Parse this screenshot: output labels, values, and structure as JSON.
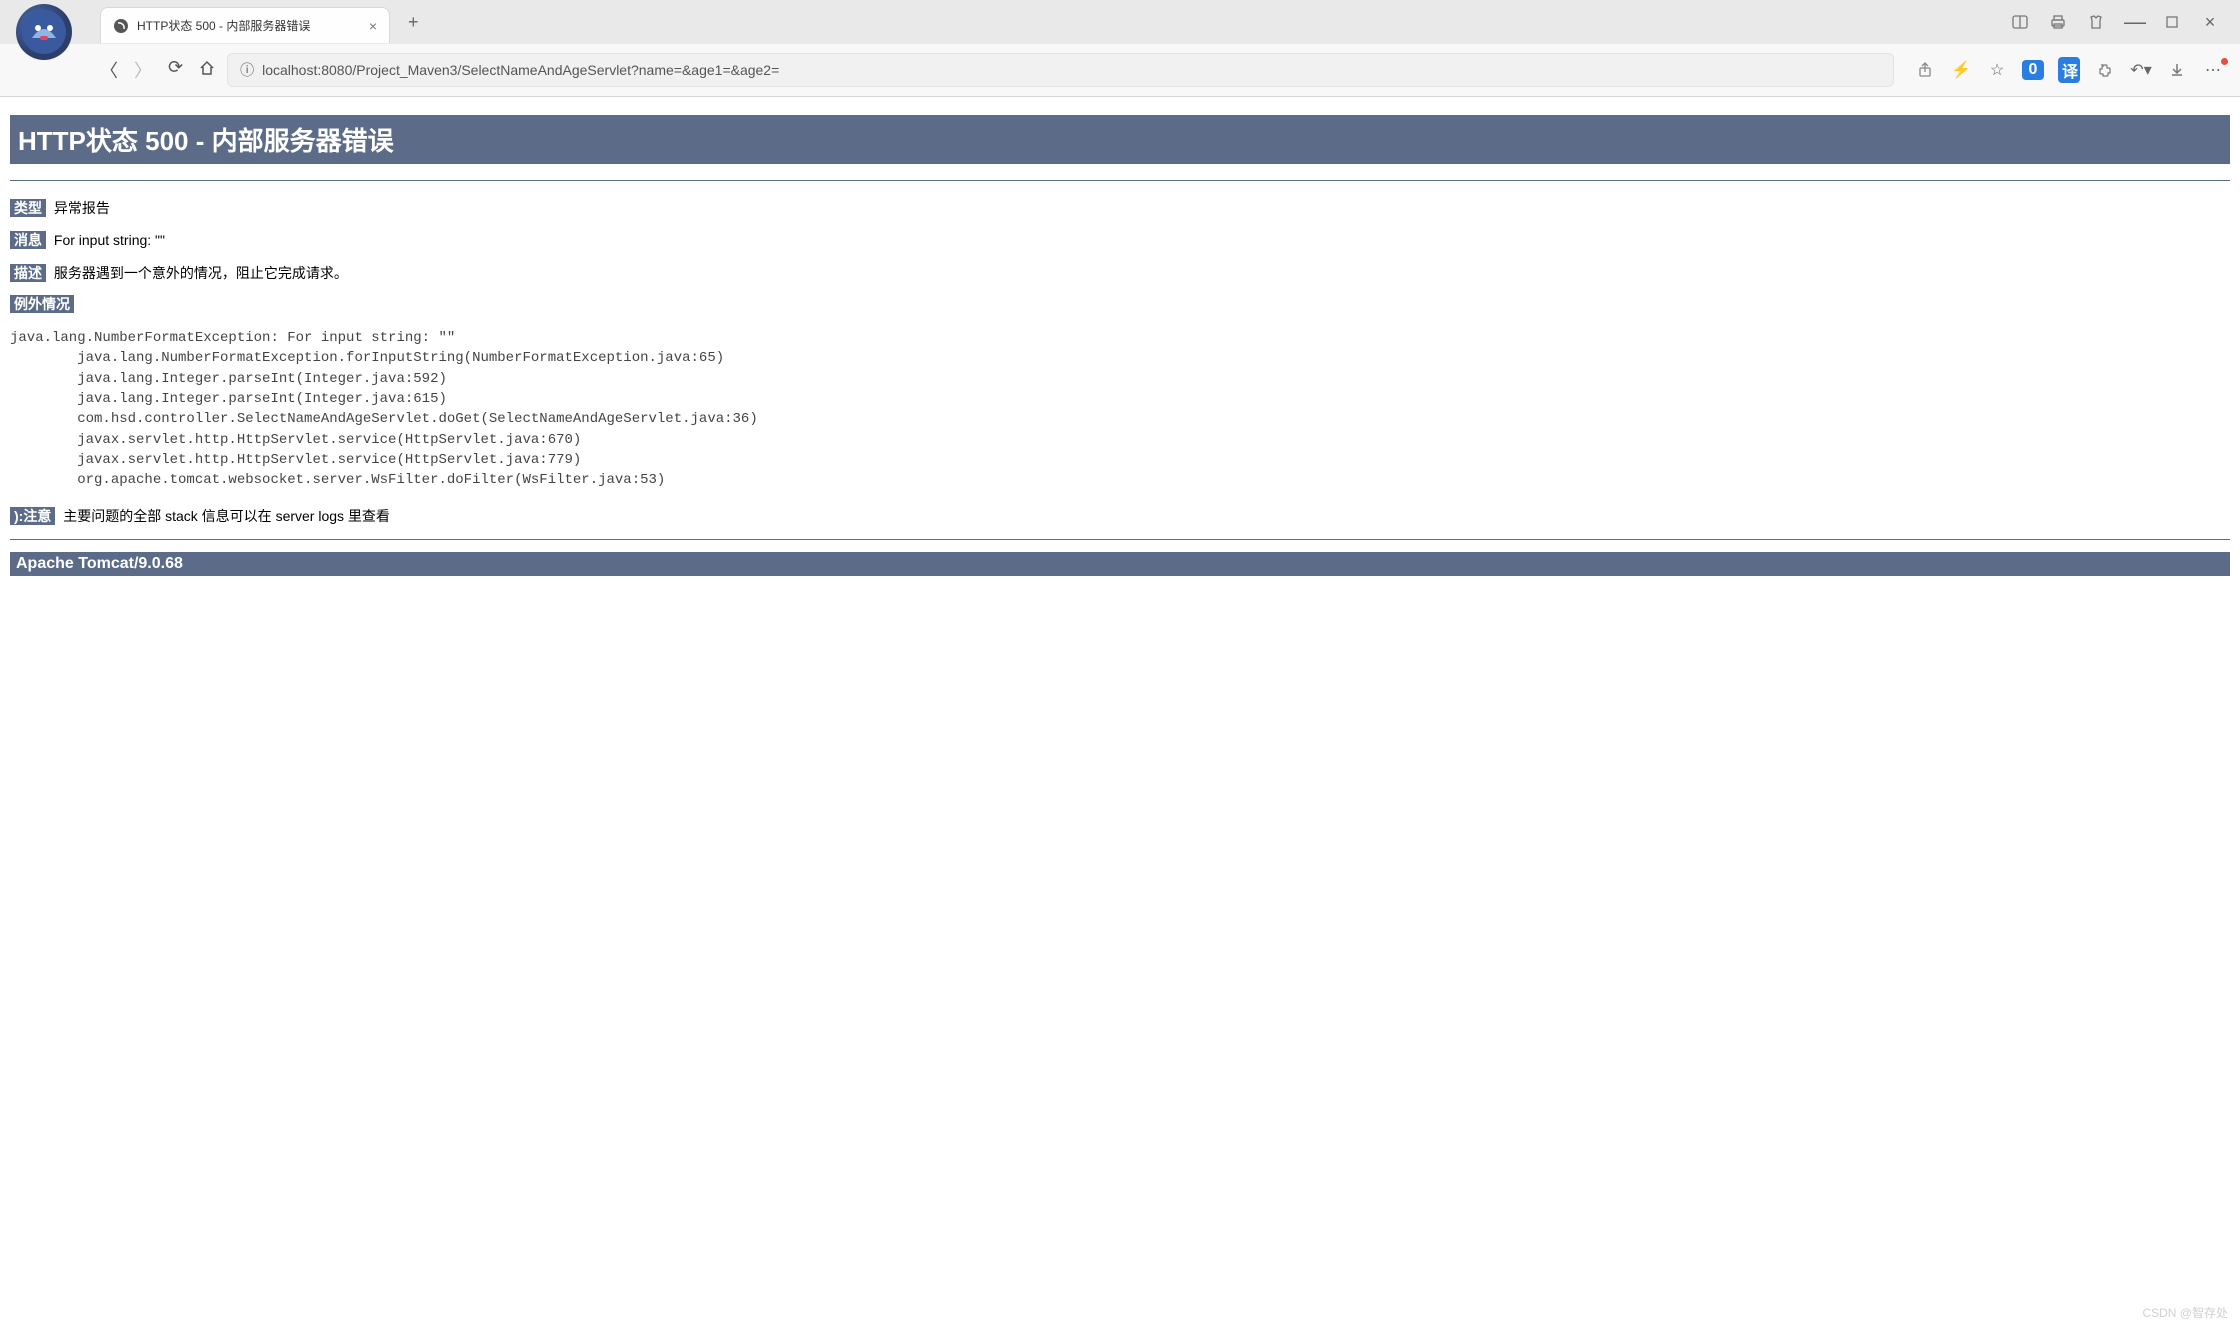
{
  "browser": {
    "tab_title": "HTTP状态 500 - 内部服务器错误",
    "new_tab": "+",
    "url": "localhost:8080/Project_Maven3/SelectNameAndAgeServlet?name=&age1=&age2=",
    "translate_badge": "译",
    "block_badge": "0"
  },
  "page": {
    "title": "HTTP状态 500 - 内部服务器错误",
    "type_label": "类型",
    "type_value": "异常报告",
    "message_label": "消息",
    "message_value": "For input string: \"\"",
    "description_label": "描述",
    "description_value": "服务器遇到一个意外的情况，阻止它完成请求。",
    "exception_label": "例外情况",
    "stacktrace": "java.lang.NumberFormatException: For input string: \"\"\n        java.lang.NumberFormatException.forInputString(NumberFormatException.java:65)\n        java.lang.Integer.parseInt(Integer.java:592)\n        java.lang.Integer.parseInt(Integer.java:615)\n        com.hsd.controller.SelectNameAndAgeServlet.doGet(SelectNameAndAgeServlet.java:36)\n        javax.servlet.http.HttpServlet.service(HttpServlet.java:670)\n        javax.servlet.http.HttpServlet.service(HttpServlet.java:779)\n        org.apache.tomcat.websocket.server.WsFilter.doFilter(WsFilter.java:53)",
    "note_label": "):注意",
    "note_value": "主要问题的全部 stack 信息可以在 server logs 里查看",
    "footer": "Apache Tomcat/9.0.68"
  },
  "watermark": "CSDN @智存处"
}
